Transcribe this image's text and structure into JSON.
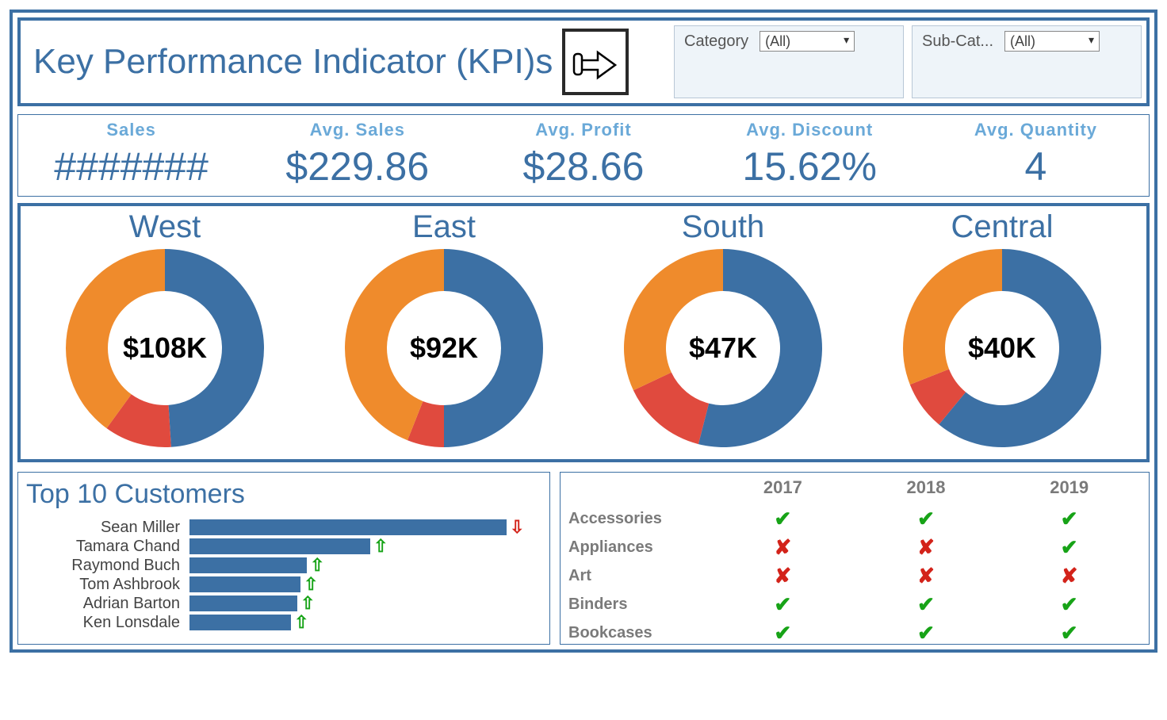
{
  "header": {
    "title": "Key Performance Indicator (KPI)s",
    "filters": [
      {
        "label": "Category",
        "value": "(All)"
      },
      {
        "label": "Sub-Cat...",
        "value": "(All)"
      }
    ]
  },
  "kpis": [
    {
      "label": "Sales",
      "value": "#######"
    },
    {
      "label": "Avg. Sales",
      "value": "$229.86"
    },
    {
      "label": "Avg. Profit",
      "value": "$28.66"
    },
    {
      "label": "Avg. Discount",
      "value": "15.62%"
    },
    {
      "label": "Avg. Quantity",
      "value": "4"
    }
  ],
  "regions": [
    {
      "name": "West",
      "center": "$108K",
      "slices": [
        {
          "color": "#3c70a4",
          "pct": 49
        },
        {
          "color": "#e04a3e",
          "pct": 11
        },
        {
          "color": "#ef8b2c",
          "pct": 40
        }
      ]
    },
    {
      "name": "East",
      "center": "$92K",
      "slices": [
        {
          "color": "#3c70a4",
          "pct": 50
        },
        {
          "color": "#e04a3e",
          "pct": 6
        },
        {
          "color": "#ef8b2c",
          "pct": 44
        }
      ]
    },
    {
      "name": "South",
      "center": "$47K",
      "slices": [
        {
          "color": "#3c70a4",
          "pct": 54
        },
        {
          "color": "#e04a3e",
          "pct": 14
        },
        {
          "color": "#ef8b2c",
          "pct": 32
        }
      ]
    },
    {
      "name": "Central",
      "center": "$40K",
      "slices": [
        {
          "color": "#3c70a4",
          "pct": 61
        },
        {
          "color": "#e04a3e",
          "pct": 8
        },
        {
          "color": "#ef8b2c",
          "pct": 31
        }
      ]
    }
  ],
  "top_customers": {
    "title": "Top 10 Customers",
    "rows": [
      {
        "name": "Sean Miller",
        "value": 100,
        "trend": "down"
      },
      {
        "name": "Tamara Chand",
        "value": 57,
        "trend": "up"
      },
      {
        "name": "Raymond Buch",
        "value": 37,
        "trend": "up"
      },
      {
        "name": "Tom Ashbrook",
        "value": 35,
        "trend": "up"
      },
      {
        "name": "Adrian Barton",
        "value": 34,
        "trend": "up"
      },
      {
        "name": "Ken Lonsdale",
        "value": 32,
        "trend": "up"
      }
    ]
  },
  "matrix": {
    "years": [
      "2017",
      "2018",
      "2019"
    ],
    "rows": [
      {
        "label": "Accessories",
        "cells": [
          "tick",
          "tick",
          "tick"
        ]
      },
      {
        "label": "Appliances",
        "cells": [
          "cross",
          "cross",
          "tick"
        ]
      },
      {
        "label": "Art",
        "cells": [
          "cross",
          "cross",
          "cross"
        ]
      },
      {
        "label": "Binders",
        "cells": [
          "tick",
          "tick",
          "tick"
        ]
      },
      {
        "label": "Bookcases",
        "cells": [
          "tick",
          "tick",
          "tick"
        ]
      }
    ]
  },
  "chart_data": [
    {
      "type": "pie",
      "title": "West",
      "series": [
        {
          "name": "Blue",
          "values": [
            49
          ]
        },
        {
          "name": "Red",
          "values": [
            11
          ]
        },
        {
          "name": "Orange",
          "values": [
            40
          ]
        }
      ],
      "center_label": "$108K"
    },
    {
      "type": "pie",
      "title": "East",
      "series": [
        {
          "name": "Blue",
          "values": [
            50
          ]
        },
        {
          "name": "Red",
          "values": [
            6
          ]
        },
        {
          "name": "Orange",
          "values": [
            44
          ]
        }
      ],
      "center_label": "$92K"
    },
    {
      "type": "pie",
      "title": "South",
      "series": [
        {
          "name": "Blue",
          "values": [
            54
          ]
        },
        {
          "name": "Red",
          "values": [
            14
          ]
        },
        {
          "name": "Orange",
          "values": [
            32
          ]
        }
      ],
      "center_label": "$47K"
    },
    {
      "type": "pie",
      "title": "Central",
      "series": [
        {
          "name": "Blue",
          "values": [
            61
          ]
        },
        {
          "name": "Red",
          "values": [
            8
          ]
        },
        {
          "name": "Orange",
          "values": [
            31
          ]
        }
      ],
      "center_label": "$40K"
    },
    {
      "type": "bar",
      "title": "Top 10 Customers",
      "categories": [
        "Sean Miller",
        "Tamara Chand",
        "Raymond Buch",
        "Tom Ashbrook",
        "Adrian Barton",
        "Ken Lonsdale"
      ],
      "values": [
        100,
        57,
        37,
        35,
        34,
        32
      ],
      "xlabel": "",
      "ylabel": "",
      "ylim": [
        0,
        100
      ]
    },
    {
      "type": "table",
      "title": "Category performance by year",
      "columns": [
        "",
        "2017",
        "2018",
        "2019"
      ],
      "rows": [
        [
          "Accessories",
          "✓",
          "✓",
          "✓"
        ],
        [
          "Appliances",
          "✗",
          "✗",
          "✓"
        ],
        [
          "Art",
          "✗",
          "✗",
          "✗"
        ],
        [
          "Binders",
          "✓",
          "✓",
          "✓"
        ],
        [
          "Bookcases",
          "✓",
          "✓",
          "✓"
        ]
      ]
    }
  ]
}
